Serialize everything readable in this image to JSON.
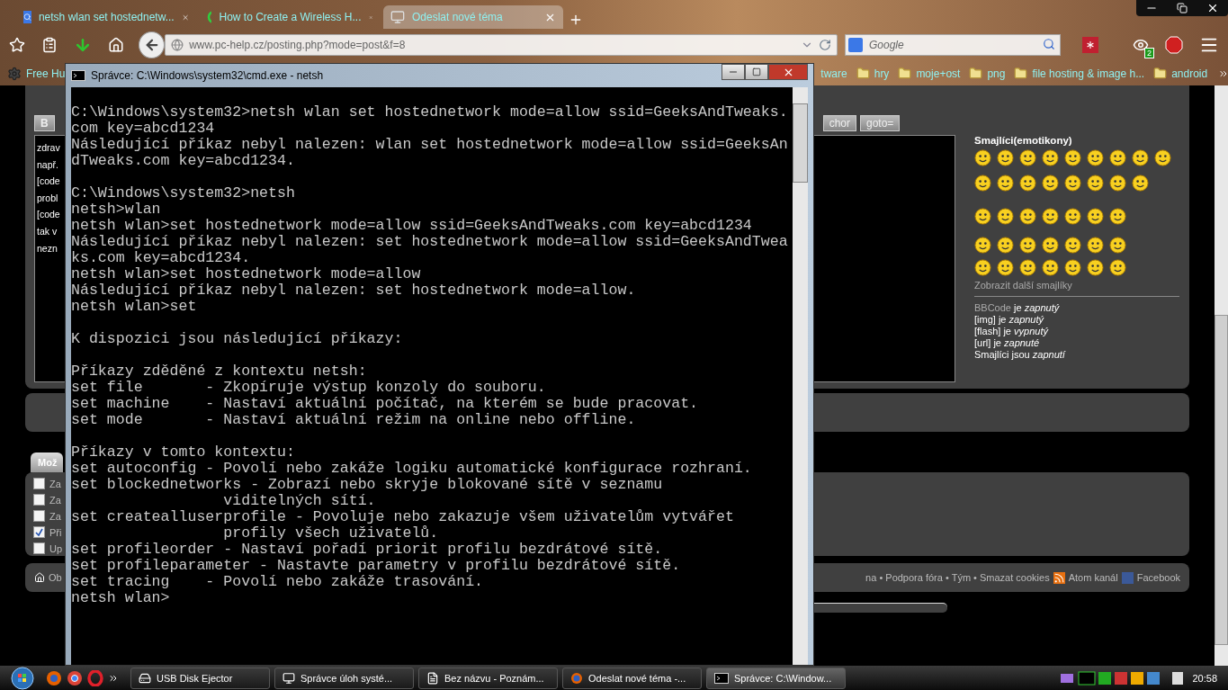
{
  "browser": {
    "tabs": [
      {
        "title": "netsh wlan set hostednetw...",
        "selected": false
      },
      {
        "title": "How to Create a Wireless H...",
        "selected": false
      },
      {
        "title": "Odeslat nové téma",
        "selected": true
      }
    ],
    "url": "www.pc-help.cz/posting.php?mode=post&f=8",
    "search": {
      "placeholder": "Google"
    },
    "extension_badge": "2",
    "bookmarks": [
      {
        "label": "Free Hu",
        "kind": "gear"
      },
      {
        "label": "tware",
        "kind": "plain"
      },
      {
        "label": "hry",
        "kind": "folder"
      },
      {
        "label": "moje+ost",
        "kind": "folder"
      },
      {
        "label": "png",
        "kind": "folder"
      },
      {
        "label": "file hosting & image h...",
        "kind": "folder"
      },
      {
        "label": "android",
        "kind": "folder"
      }
    ]
  },
  "editor": {
    "buttons_left": [
      "B"
    ],
    "buttons_right": [
      "chor",
      "goto="
    ],
    "text_lines": [
      "zdrav",
      "např.",
      "[code",
      "probl",
      "[code",
      "tak v",
      "nezn"
    ],
    "smilies": {
      "title": "Smajlíci(emotikony)",
      "more": "Zobrazit další smajlíky",
      "status": [
        {
          "link": "BBCode",
          "text": "je *zapnutý*"
        },
        {
          "text": "[img] je *zapnutý*"
        },
        {
          "text": "[flash] je *vypnutý*"
        },
        {
          "text": "[url] je *zapnuté*"
        },
        {
          "text": "Smajlíci jsou *zapnutí*"
        }
      ]
    }
  },
  "options": {
    "tab": "Mož",
    "items": [
      {
        "label": "Za",
        "checked": false
      },
      {
        "label": "Za",
        "checked": false
      },
      {
        "label": "Za",
        "checked": false
      },
      {
        "label": "Při",
        "checked": true
      },
      {
        "label": "Up",
        "checked": false
      }
    ]
  },
  "footer": {
    "left": "Ob",
    "links": "na • Podpora fóra • Tým • Smazat cookies",
    "atom": "Atom kanál",
    "facebook": "Facebook"
  },
  "console": {
    "title": "Správce: C:\\Windows\\system32\\cmd.exe - netsh",
    "blocks": [
      [
        "C:\\Windows\\system32>netsh wlan set hostednetwork mode=allow ssid=GeeksAndTweaks.",
        "com key=abcd1234",
        "Následující příkaz nebyl nalezen: wlan set hostednetwork mode=allow ssid=GeeksAn",
        "dTweaks.com key=abcd1234."
      ],
      [
        "C:\\Windows\\system32>netsh",
        "netsh>wlan",
        "netsh wlan>set hostednetwork mode=allow ssid=GeeksAndTweaks.com key=abcd1234",
        "Následující příkaz nebyl nalezen: set hostednetwork mode=allow ssid=GeeksAndTwea",
        "ks.com key=abcd1234.",
        "netsh wlan>set hostednetwork mode=allow",
        "Následující příkaz nebyl nalezen: set hostednetwork mode=allow.",
        "netsh wlan>set"
      ],
      [
        "K dispozici jsou následující příkazy:"
      ],
      [
        "Příkazy zděděné z kontextu netsh:",
        "set file       - Zkopíruje výstup konzoly do souboru.",
        "set machine    - Nastaví aktuální počítač, na kterém se bude pracovat.",
        "set mode       - Nastaví aktuální režim na online nebo offline."
      ],
      [
        "Příkazy v tomto kontextu:",
        "set autoconfig - Povolí nebo zakáže logiku automatické konfigurace rozhraní.",
        "set blockednetworks - Zobrazí nebo skryje blokované sítě v seznamu",
        "                 viditelných sítí.",
        "set createalluserprofile - Povoluje nebo zakazuje všem uživatelům vytvářet",
        "                 profily všech uživatelů.",
        "set profileorder - Nastaví pořadí priorit profilu bezdrátové sítě.",
        "set profileparameter - Nastavte parametry v profilu bezdrátové sítě.",
        "set tracing    - Povolí nebo zakáže trasování.",
        "netsh wlan>"
      ]
    ]
  },
  "taskbar": {
    "tasks": [
      {
        "label": "USB Disk Ejector",
        "selected": false
      },
      {
        "label": "Správce úloh systé...",
        "selected": false
      },
      {
        "label": "Bez názvu - Poznám...",
        "selected": false
      },
      {
        "label": "Odeslat nové téma -...",
        "selected": false
      },
      {
        "label": "Správce: C:\\Window...",
        "selected": true
      }
    ],
    "clock": "20:58"
  }
}
